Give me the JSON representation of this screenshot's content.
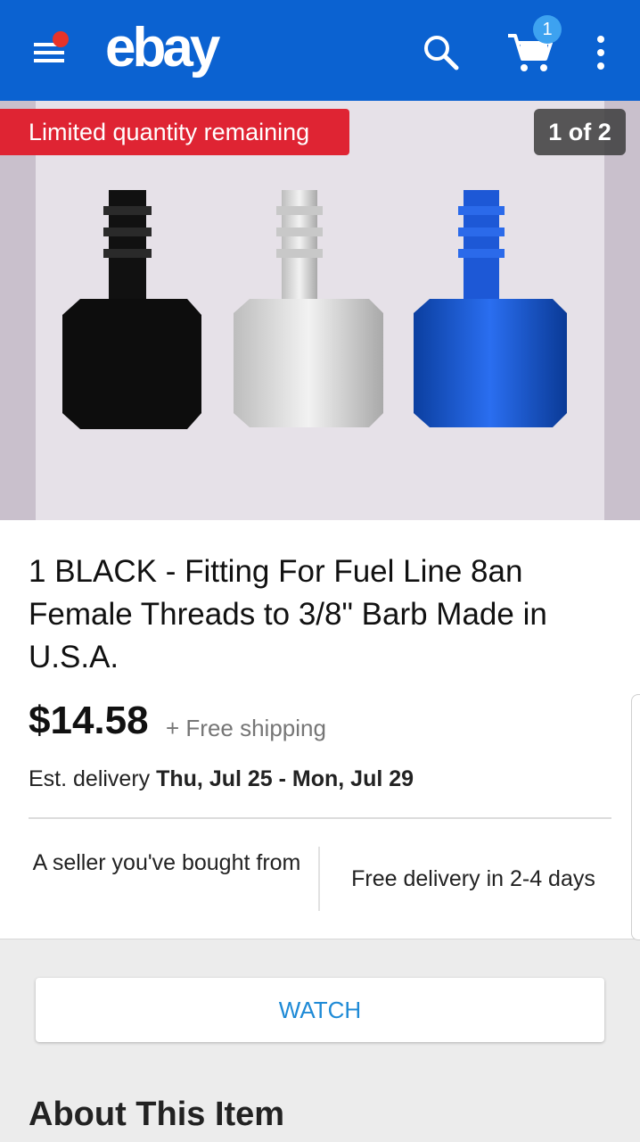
{
  "app": {
    "logo": "ebay",
    "cart_count": "1"
  },
  "gallery": {
    "badge": "Limited quantity remaining",
    "counter": "1 of 2"
  },
  "item": {
    "title": "1 BLACK - Fitting For  Fuel Line 8an Female Threads to 3/8\" Barb Made in U.S.A.",
    "price": "$14.58",
    "shipping": "+ Free shipping",
    "delivery_prefix": "Est. delivery ",
    "delivery_dates": "Thu, Jul 25 - Mon, Jul 29",
    "feature_left": "A seller you've bought from",
    "feature_right": "Free delivery in 2-4 days"
  },
  "actions": {
    "watch_label": "WATCH"
  },
  "sections": {
    "about_title": "About This Item"
  },
  "colors": {
    "appbar": "#0b62d1",
    "limited_badge": "#df2433",
    "watch_text": "#1e8ad6",
    "notification_dot": "#e6332a"
  },
  "icons": [
    "menu-icon",
    "search-icon",
    "cart-icon",
    "more-vert-icon"
  ]
}
